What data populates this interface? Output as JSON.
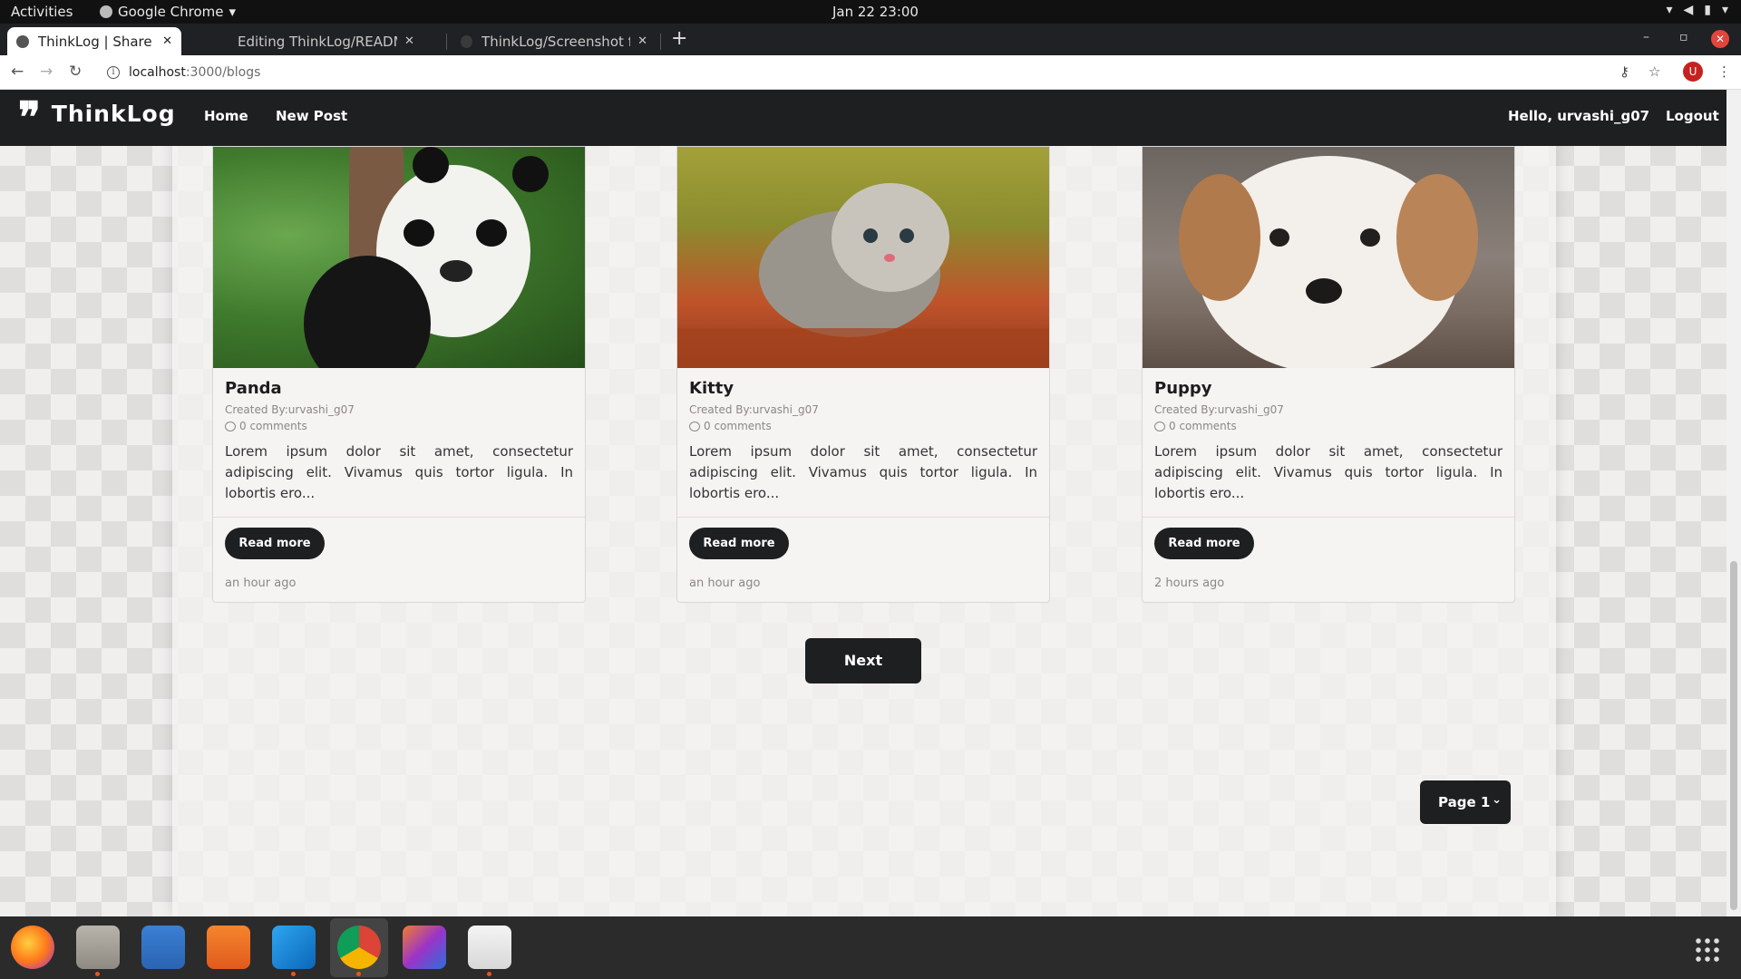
{
  "system": {
    "activities": "Activities",
    "app_name": "Google Chrome",
    "clock": "Jan 22  23:00"
  },
  "browser": {
    "tabs": [
      {
        "title": "ThinkLog | Share Your Tho",
        "active": true
      },
      {
        "title": "Editing ThinkLog/READM",
        "active": false
      },
      {
        "title": "ThinkLog/Screenshot fro",
        "active": false
      }
    ],
    "url_host": "localhost",
    "url_path": ":3000/blogs",
    "profile_initial": "U"
  },
  "navbar": {
    "brand": "ThinkLog",
    "brand_icon": "quote-icon",
    "links": [
      "Home",
      "New Post"
    ],
    "greeting": "Hello, urvashi_g07",
    "logout": "Logout"
  },
  "posts": [
    {
      "title": "Panda",
      "author": "Created By:urvashi_g07",
      "comments": "0 comments",
      "excerpt": "Lorem ipsum dolor sit amet, consectetur adipiscing elit. Vivamus quis tortor ligula. In lobortis ero...",
      "read_more": "Read more",
      "time": "an hour ago"
    },
    {
      "title": "Kitty",
      "author": "Created By:urvashi_g07",
      "comments": "0 comments",
      "excerpt": "Lorem ipsum dolor sit amet, consectetur adipiscing elit. Vivamus quis tortor ligula. In lobortis ero...",
      "read_more": "Read more",
      "time": "an hour ago"
    },
    {
      "title": "Puppy",
      "author": "Created By:urvashi_g07",
      "comments": "0 comments",
      "excerpt": "Lorem ipsum dolor sit amet, consectetur adipiscing elit. Vivamus quis tortor ligula. In lobortis ero...",
      "read_more": "Read more",
      "time": "2 hours ago"
    }
  ],
  "pagination": {
    "next": "Next",
    "page_select": "Page 1"
  },
  "colors": {
    "navbar_bg": "#1e1f21",
    "page_bg": "#f1efee",
    "button_bg": "#1e1f21",
    "close_red": "#e2453c"
  }
}
